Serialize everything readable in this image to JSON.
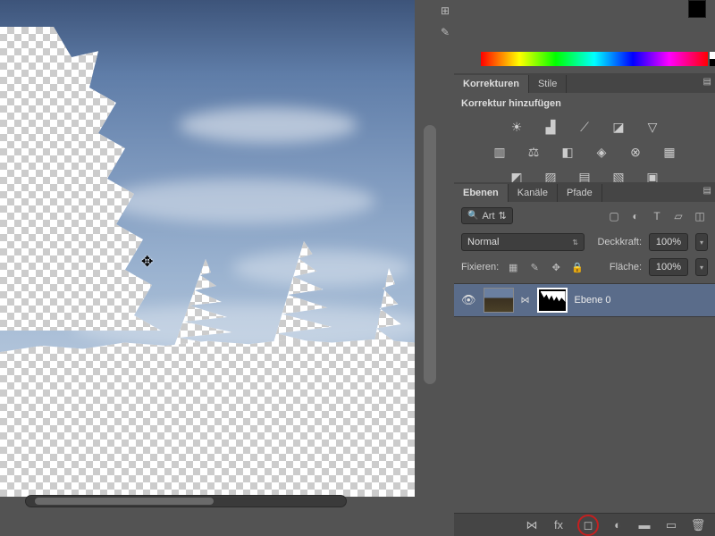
{
  "canvas": {
    "cursor_glyph": "✥"
  },
  "adjustments": {
    "tab1": "Korrekturen",
    "tab2": "Stile",
    "title": "Korrektur hinzufügen"
  },
  "layers": {
    "tab1": "Ebenen",
    "tab2": "Kanäle",
    "tab3": "Pfade",
    "filter_label": "Art",
    "blend_mode": "Normal",
    "opacity_label": "Deckkraft:",
    "opacity_value": "100%",
    "lock_label": "Fixieren:",
    "fill_label": "Fläche:",
    "fill_value": "100%",
    "layer0": {
      "name": "Ebene 0"
    }
  },
  "icons": {
    "brightness": "☀",
    "levels": "▟",
    "curves": "⟋",
    "exposure": "◪",
    "triangle": "▽",
    "vibrance": "▥",
    "balance": "⚖",
    "bw": "◧",
    "photo": "◈",
    "channel": "⊗",
    "lut": "▦",
    "invert": "◩",
    "poster": "▨",
    "thresh": "▤",
    "gradmap": "▧",
    "select": "▣",
    "filter_img": "▢",
    "filter_fx": "◐",
    "filter_t": "T",
    "filter_shape": "▱",
    "filter_smart": "◫",
    "lock_trans": "▦",
    "lock_brush": "✎",
    "lock_move": "✥",
    "lock_all": "🔒",
    "eye": "👁",
    "foot_link": "⋈",
    "foot_fx": "fx",
    "foot_mask": "◻",
    "foot_adj": "◐",
    "foot_group": "▬",
    "foot_new": "▭",
    "foot_trash": "🗑",
    "hist": "⊞",
    "note": "✎"
  }
}
